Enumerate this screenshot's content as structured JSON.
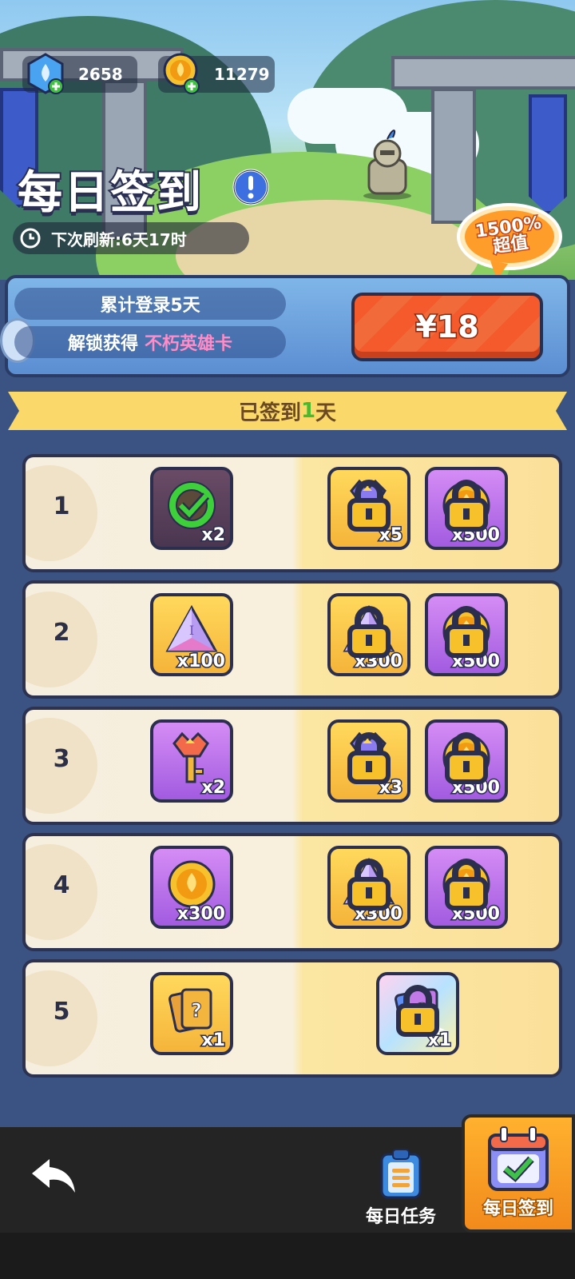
{
  "currency": {
    "gems": "2658",
    "coins": "11279"
  },
  "header": {
    "title": "每日签到",
    "refresh": "下次刷新:6天17时",
    "badge_line1": "1500%",
    "badge_line2": "超值"
  },
  "unlock_panel": {
    "line1": "累计登录5天",
    "line2_prefix": "解锁获得",
    "line2_highlight": "不朽英雄卡",
    "price": "¥18"
  },
  "signed": {
    "prefix": "已签到",
    "days": "1",
    "suffix": "天"
  },
  "days": [
    {
      "day": "1",
      "free": {
        "icon": "sickle-item-icon",
        "qty": "x2",
        "claimed": true
      },
      "locked": [
        {
          "icon": "key-icon",
          "qty": "x5"
        },
        {
          "icon": "gold-coin-icon",
          "qty": "x500"
        }
      ]
    },
    {
      "day": "2",
      "free": {
        "icon": "crystal-icon",
        "qty": "x100"
      },
      "locked": [
        {
          "icon": "crystal-icon",
          "qty": "x300"
        },
        {
          "icon": "gold-coin-icon",
          "qty": "x500"
        }
      ]
    },
    {
      "day": "3",
      "free": {
        "icon": "key-icon",
        "qty": "x2"
      },
      "locked": [
        {
          "icon": "key-icon",
          "qty": "x3"
        },
        {
          "icon": "gold-coin-icon",
          "qty": "x500"
        }
      ]
    },
    {
      "day": "4",
      "free": {
        "icon": "gold-coin-icon",
        "qty": "x300"
      },
      "locked": [
        {
          "icon": "crystal-icon",
          "qty": "x300"
        },
        {
          "icon": "gold-coin-icon",
          "qty": "x500"
        }
      ]
    },
    {
      "day": "5",
      "free": {
        "icon": "mystery-card-icon",
        "qty": "x1"
      },
      "locked": [
        {
          "icon": "rainbow-card-icon",
          "qty": "x1"
        }
      ]
    }
  ],
  "bottom_nav": {
    "daily_tasks": "每日任务",
    "daily_signin": "每日签到"
  },
  "colors": {
    "background": "#3b5383",
    "price_button": "#f45a2c",
    "highlight_pink": "#ff8cc6",
    "signed_green": "#4cb82f",
    "active_tab": "#ffb12e"
  }
}
